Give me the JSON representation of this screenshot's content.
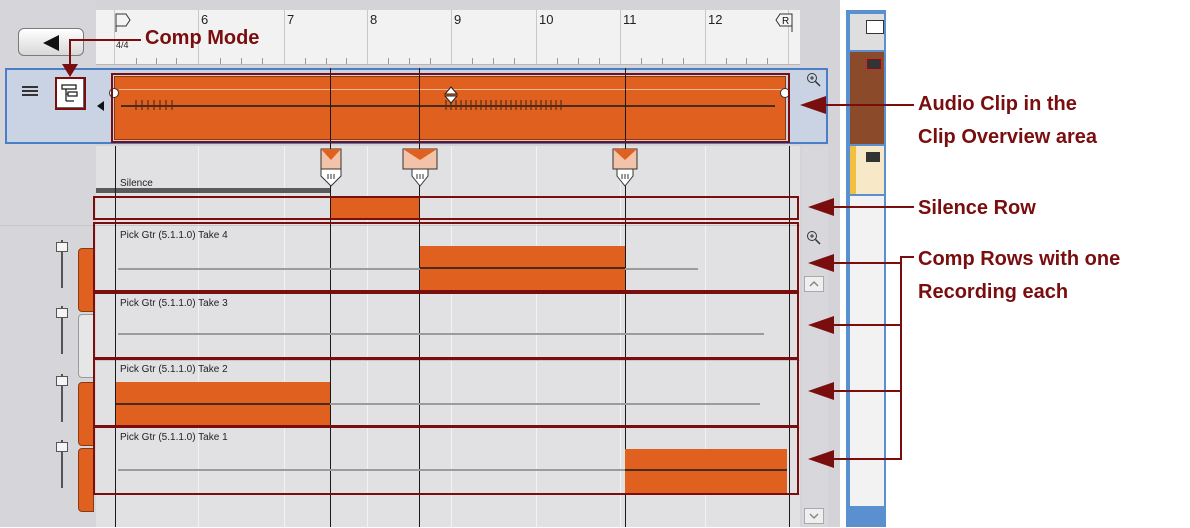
{
  "ruler": {
    "time_signature": "4/4",
    "bars": [
      "6",
      "7",
      "8",
      "9",
      "10",
      "11",
      "12"
    ],
    "end_marker": "R"
  },
  "rows": {
    "silence_label": "Silence",
    "take4_label": "Pick Gtr (5.1.1.0) Take 4",
    "take3_label": "Pick Gtr (5.1.1.0) Take 3",
    "take2_label": "Pick Gtr (5.1.1.0) Take 2",
    "take1_label": "Pick Gtr (5.1.1.0) Take 1"
  },
  "annotations": {
    "comp_mode": "Comp Mode",
    "audio_clip_line1": "Audio Clip in the",
    "audio_clip_line2": "Clip Overview area",
    "silence_row": "Silence Row",
    "comp_rows_line1": "Comp Rows with one",
    "comp_rows_line2": "Recording each"
  },
  "icons": {
    "back": "back-arrow-icon",
    "lanes_view": "lanes-view-icon",
    "comp_mode": "comp-mode-icon",
    "zoom": "zoom-icon"
  },
  "colors": {
    "clip_orange": "#e0601f",
    "annotation_red": "#7a0e0e",
    "overview_blue": "#4a7fc8"
  }
}
